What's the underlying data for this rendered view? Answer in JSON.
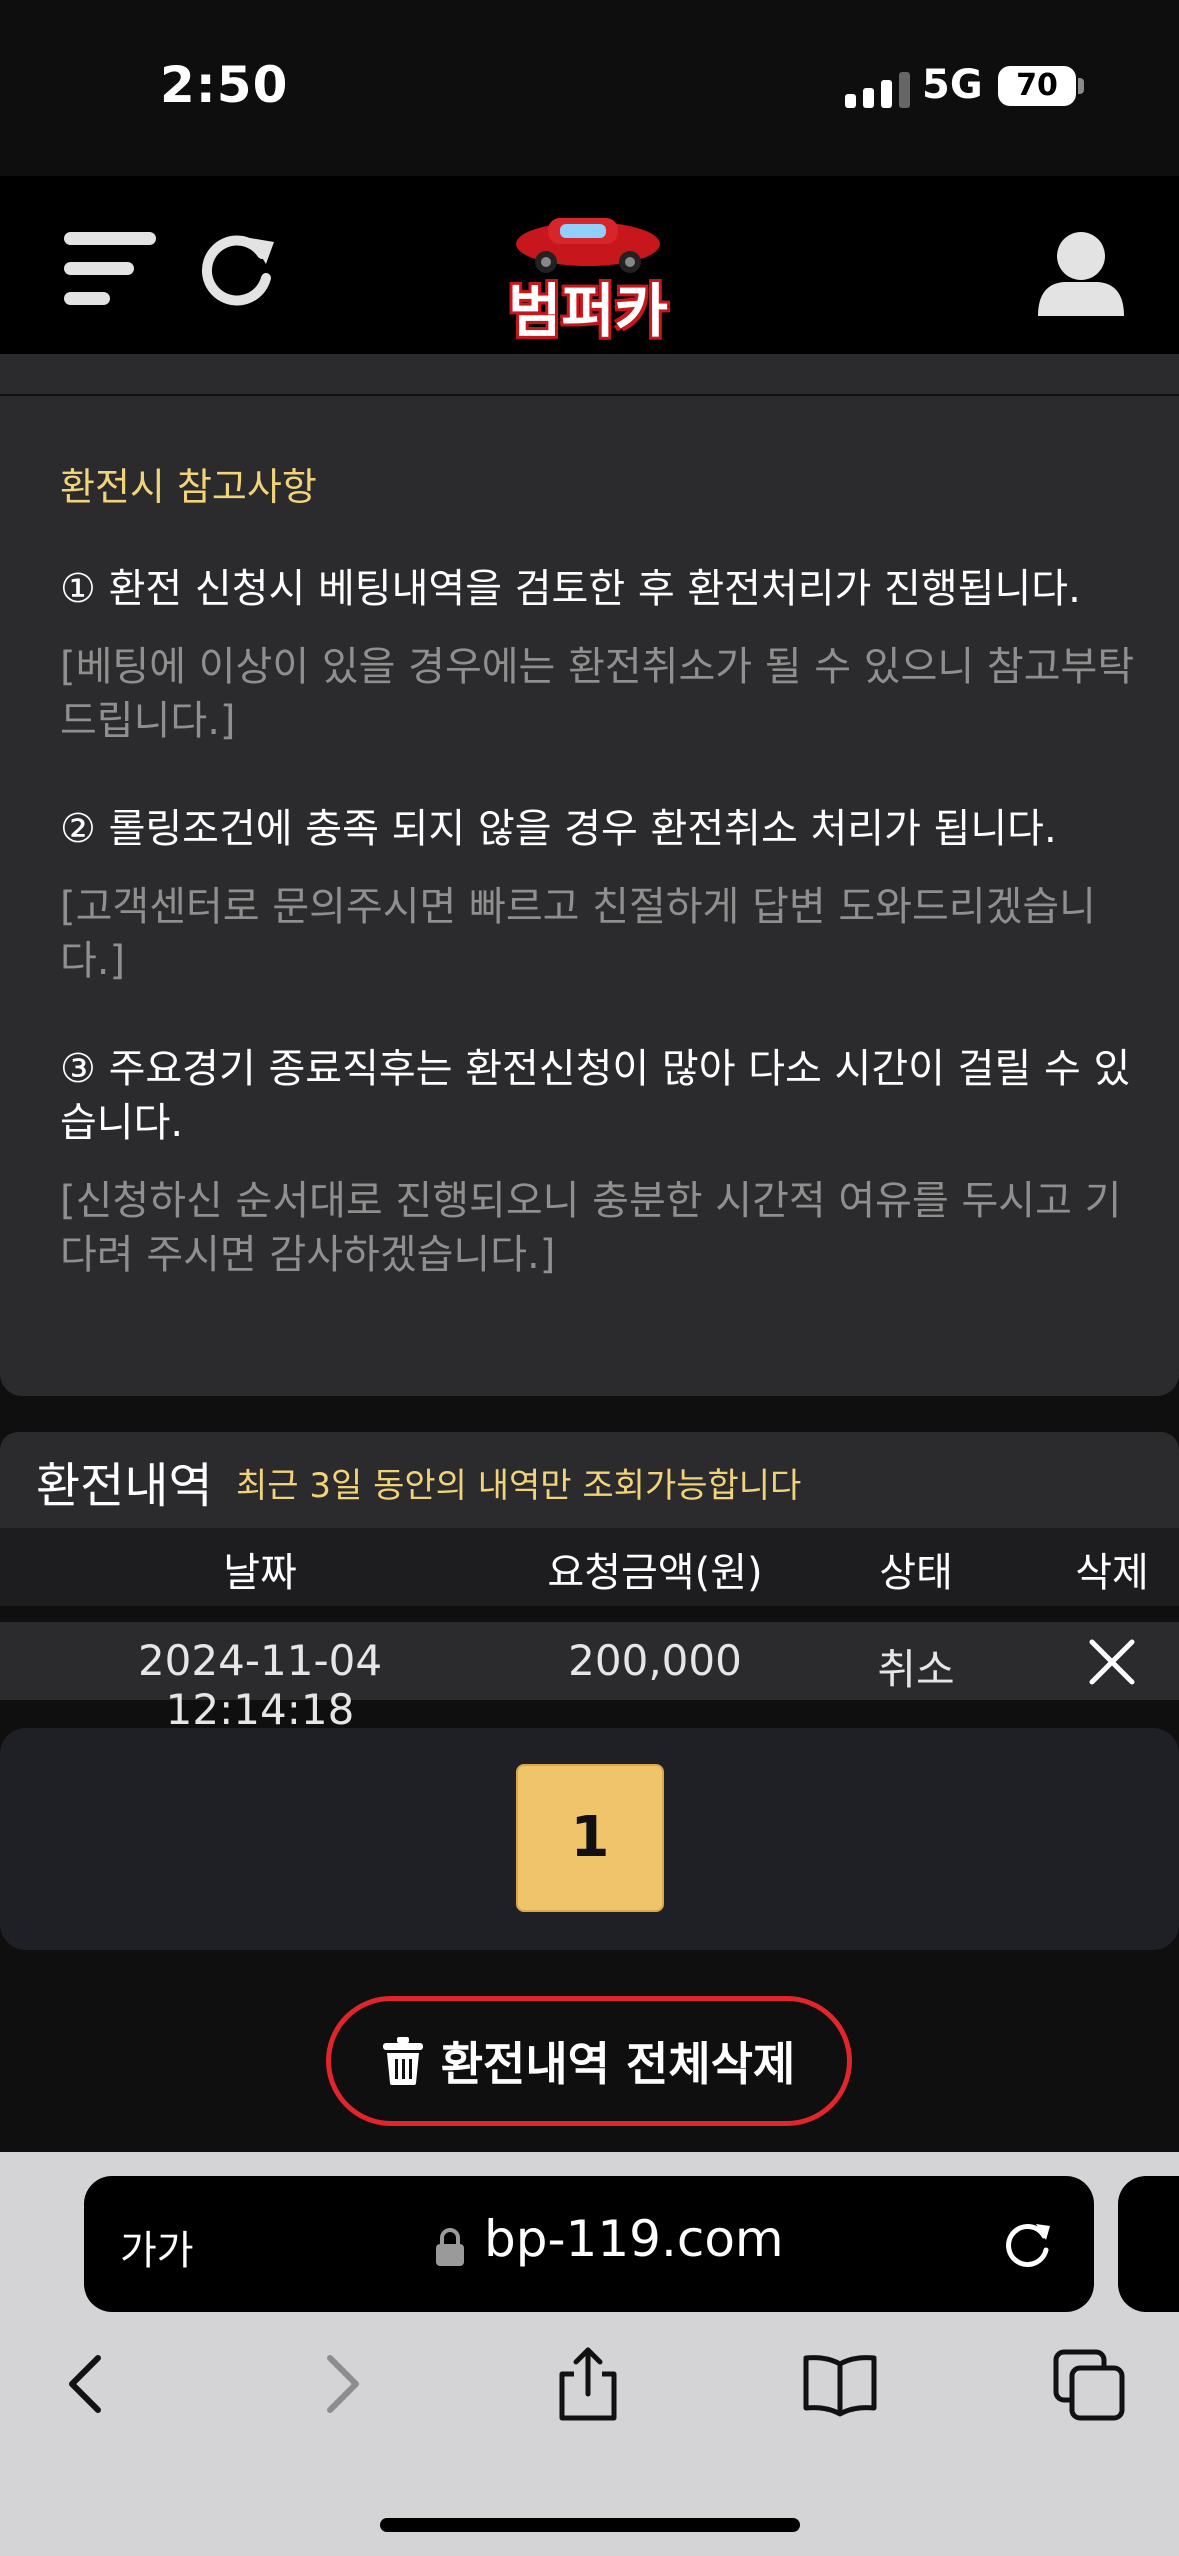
{
  "status_bar": {
    "time": "2:50",
    "network": "5G",
    "battery": "70"
  },
  "header": {
    "logo_text": "범퍼카"
  },
  "notice": {
    "title": "환전시 참고사항",
    "items": [
      {
        "main": "① 환전 신청시 베팅내역을 검토한 후 환전처리가 진행됩니다.",
        "sub": "[베팅에 이상이 있을 경우에는 환전취소가 될 수 있으니 참고부탁드립니다.]"
      },
      {
        "main": "② 롤링조건에 충족 되지 않을 경우 환전취소 처리가 됩니다.",
        "sub": "[고객센터로 문의주시면 빠르고 친절하게 답변 도와드리겠습니다.]"
      },
      {
        "main": "③ 주요경기 종료직후는 환전신청이 많아 다소 시간이 걸릴 수 있습니다.",
        "sub": "[신청하신 순서대로 진행되오니 충분한 시간적 여유를 두시고 기다려 주시면 감사하겠습니다.]"
      }
    ]
  },
  "history": {
    "title": "환전내역",
    "note": "최근 3일 동안의 내역만 조회가능합니다",
    "columns": [
      "날짜",
      "요청금액(원)",
      "상태",
      "삭제"
    ],
    "rows": [
      {
        "date": "2024-11-04 12:14:18",
        "amount": "200,000",
        "status": "취소"
      }
    ]
  },
  "pagination": {
    "current": "1"
  },
  "delete_all": {
    "label": "환전내역 전체삭제"
  },
  "browser": {
    "aa": "가가",
    "url": "bp-119.com"
  },
  "colors": {
    "accent_yellow": "#f1d37a",
    "page_button": "#efc46b",
    "delete_red": "#e0252b",
    "card_bg": "#2b2b2d"
  }
}
